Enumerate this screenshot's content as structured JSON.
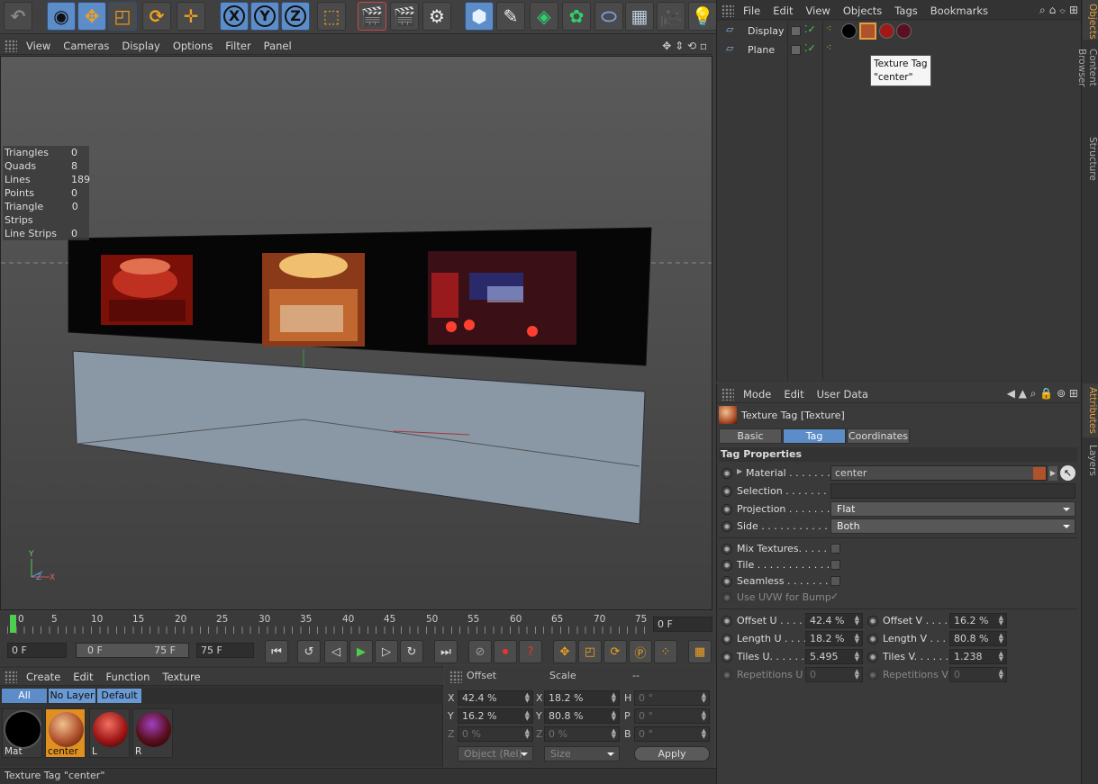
{
  "toolbar": {
    "buttons": [
      "undo",
      "live-select",
      "move",
      "scale",
      "rotate",
      "move-axis",
      "x-axis",
      "y-axis",
      "z-axis",
      "coordinate-system",
      "render-view",
      "render-picture-viewer",
      "render-settings",
      "cube",
      "pen",
      "subdivision",
      "array",
      "deformer",
      "floor",
      "camera",
      "light"
    ],
    "axis_x": "X",
    "axis_y": "Y",
    "axis_z": "Z"
  },
  "viewport_menu": [
    "View",
    "Cameras",
    "Display",
    "Options",
    "Filter",
    "Panel"
  ],
  "stats": [
    {
      "label": "Triangles",
      "value": "0"
    },
    {
      "label": "Quads",
      "value": "8"
    },
    {
      "label": "Lines",
      "value": "189"
    },
    {
      "label": "Points",
      "value": "0"
    },
    {
      "label": "Triangle Strips",
      "value": "0"
    },
    {
      "label": "Line Strips",
      "value": "0"
    }
  ],
  "axis_gizmo": {
    "y": "Y",
    "x": "X",
    "z": "Z"
  },
  "timeline": {
    "ticks": [
      "0",
      "5",
      "10",
      "15",
      "20",
      "25",
      "30",
      "35",
      "40",
      "45",
      "50",
      "55",
      "60",
      "65",
      "70",
      "75"
    ],
    "current_frame": "0 F"
  },
  "transport": {
    "start_field": "0 F",
    "range_start": "0 F",
    "range_end": "75 F",
    "end_field": "75 F"
  },
  "material_manager": {
    "menu": [
      "Create",
      "Edit",
      "Function",
      "Texture"
    ],
    "filters": [
      "All",
      "No Layer",
      "Default"
    ],
    "materials": [
      {
        "name": "Mat",
        "color": "#000000"
      },
      {
        "name": "center",
        "color": "#b0522c",
        "selected": true
      },
      {
        "name": "L",
        "color": "#a11818"
      },
      {
        "name": "R",
        "color": "#5a1020"
      }
    ]
  },
  "coord_manager": {
    "headers": [
      "Offset",
      "Scale",
      "--"
    ],
    "rows": [
      {
        "a": "X",
        "a_val": "42.4 %",
        "b": "X",
        "b_val": "18.2 %",
        "c": "H",
        "c_val": "0 °"
      },
      {
        "a": "Y",
        "a_val": "16.2 %",
        "b": "Y",
        "b_val": "80.8 %",
        "c": "P",
        "c_val": "0 °"
      },
      {
        "a": "Z",
        "a_val": "0 %",
        "b": "Z",
        "b_val": "0 %",
        "c": "B",
        "c_val": "0 °"
      }
    ],
    "mode_select": "Object (Rel)",
    "size_select": "Size",
    "apply_label": "Apply"
  },
  "status": "Texture Tag \"center\"",
  "object_manager": {
    "menu": [
      "File",
      "Edit",
      "View",
      "Objects",
      "Tags",
      "Bookmarks"
    ],
    "objects": [
      {
        "name": "Display"
      },
      {
        "name": "Plane"
      }
    ],
    "tooltip_line1": "Texture Tag",
    "tooltip_line2": "\"center\""
  },
  "side_tabs": [
    "Objects",
    "Content Browser",
    "Structure",
    "Attributes",
    "Layers"
  ],
  "attributes": {
    "menu": [
      "Mode",
      "Edit",
      "User Data"
    ],
    "title": "Texture Tag [Texture]",
    "tabs": [
      "Basic",
      "Tag",
      "Coordinates"
    ],
    "active_tab": "Tag",
    "section": "Tag Properties",
    "material_label": "Material . . . . . . . .",
    "material_value": "center",
    "selection_label": "Selection . . . . . . . .",
    "selection_value": "",
    "projection_label": "Projection . . . . . . .",
    "projection_value": "Flat",
    "side_label": "Side . . . . . . . . . . . .",
    "side_value": "Both",
    "mix_label": "Mix Textures. . . . . .",
    "tile_label": "Tile . . . . . . . . . . . . .",
    "seamless_label": "Seamless . . . . . . . .",
    "uvw_label": "Use UVW for Bump",
    "offset_u_label": "Offset U . . . .",
    "offset_u": "42.4 %",
    "offset_v_label": "Offset V . . . .",
    "offset_v": "16.2 %",
    "length_u_label": "Length U . . . .",
    "length_u": "18.2 %",
    "length_v_label": "Length V . . . .",
    "length_v": "80.8 %",
    "tiles_u_label": "Tiles U. . . . . .",
    "tiles_u": "5.495",
    "tiles_v_label": "Tiles V. . . . . .",
    "tiles_v": "1.238",
    "rep_u_label": "Repetitions U",
    "rep_u": "0",
    "rep_v_label": "Repetitions V",
    "rep_v": "0"
  }
}
